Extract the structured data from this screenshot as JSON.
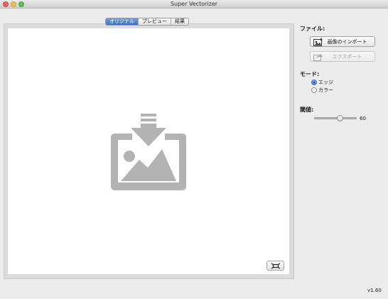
{
  "window": {
    "title": "Super Vectorizer"
  },
  "view_tabs": [
    {
      "label": "オリジナル",
      "selected": true
    },
    {
      "label": "プレビュー",
      "selected": false
    },
    {
      "label": "結果",
      "selected": false
    }
  ],
  "canvas": {
    "drop_icon": "image-import-icon",
    "fit_icon": "fit-to-window-icon"
  },
  "file_section": {
    "label": "ファイル:",
    "import_button": {
      "label": "画像のインポート",
      "icon": "image-import-icon",
      "enabled": true
    },
    "export_button": {
      "label": "エクスポート",
      "icon": "share-export-icon",
      "enabled": false
    }
  },
  "mode_section": {
    "label": "モード:",
    "options": [
      {
        "label": "エッジ",
        "selected": true
      },
      {
        "label": "カラー",
        "selected": false
      }
    ]
  },
  "threshold_section": {
    "label": "閾値:",
    "value": "60",
    "level": 0.6
  },
  "version": "v1.60",
  "colors": {
    "accent": "#3c74c0",
    "window_background": "#ececec",
    "canvas_background": "#ffffff",
    "placeholder_icon": "#b3b3b3"
  }
}
